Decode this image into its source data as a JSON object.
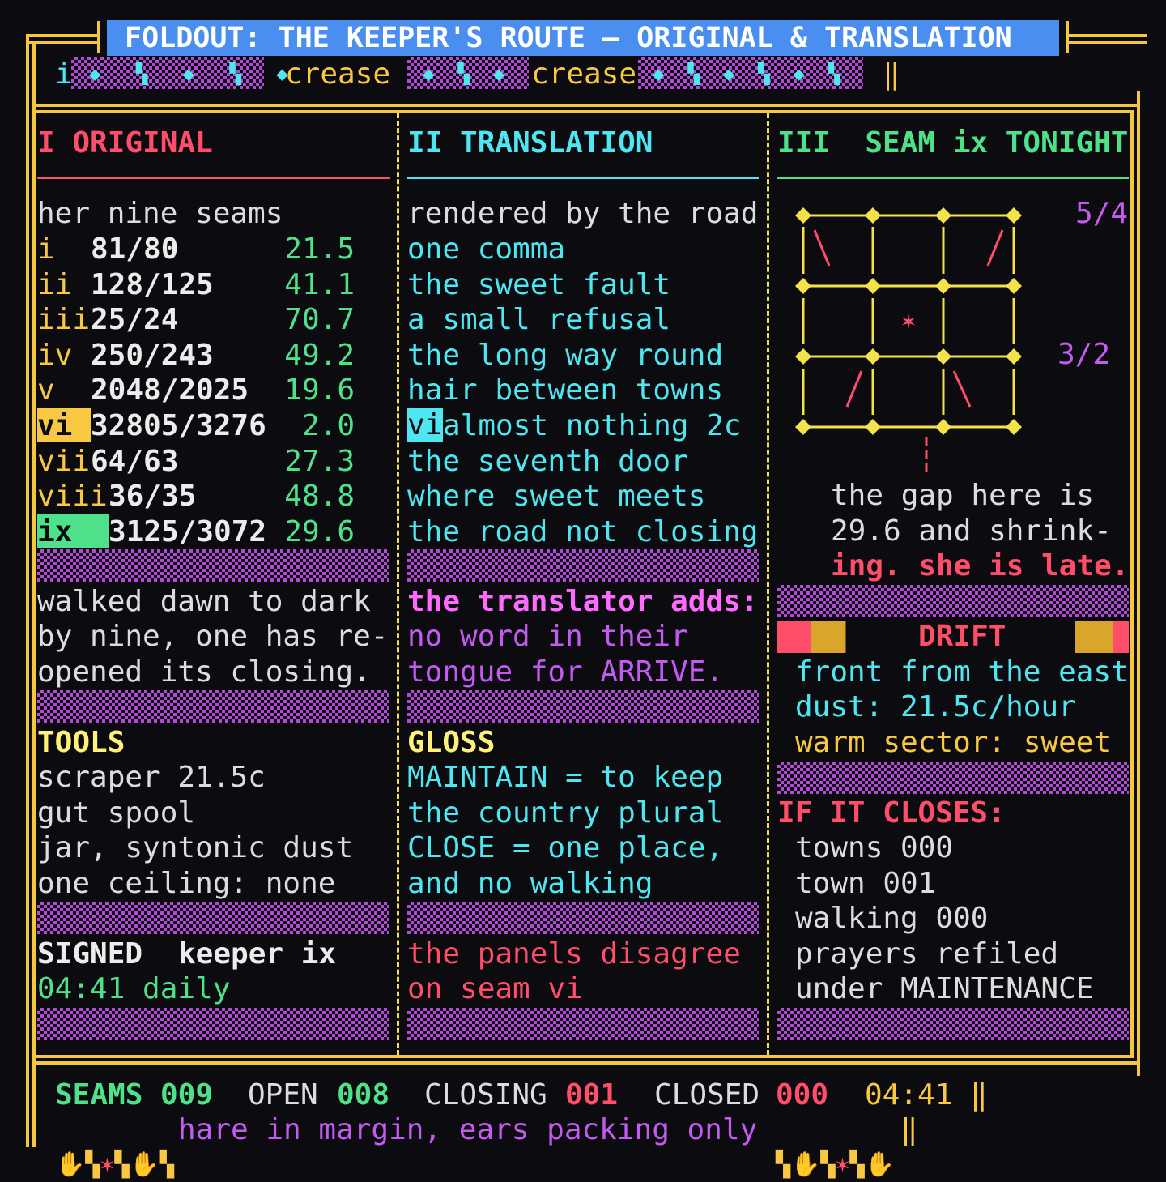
{
  "header": {
    "title": "FOLDOUT: THE KEEPER'S ROUTE — ORIGINAL & TRANSLATION",
    "ruler_left": "i",
    "crease_1": "crease",
    "crease_2": "crease"
  },
  "col1": {
    "heading": "I ORIGINAL",
    "intro": "her nine seams",
    "seams": [
      {
        "id": "i",
        "ratio": "81/80",
        "cents": "21.5"
      },
      {
        "id": "ii",
        "ratio": "128/125",
        "cents": "41.1"
      },
      {
        "id": "iii",
        "ratio": "25/24",
        "cents": "70.7"
      },
      {
        "id": "iv",
        "ratio": "250/243",
        "cents": "49.2"
      },
      {
        "id": "v",
        "ratio": "2048/2025",
        "cents": "19.6"
      },
      {
        "id": "vi",
        "ratio": "32805/3276",
        "cents": "2.0"
      },
      {
        "id": "vii",
        "ratio": "64/63",
        "cents": "27.3"
      },
      {
        "id": "viii",
        "ratio": "36/35",
        "cents": "48.8"
      },
      {
        "id": "ix",
        "ratio": "3125/3072",
        "cents": "29.6"
      }
    ],
    "para": [
      "walked dawn to dark",
      "by nine, one has re-",
      "opened its closing."
    ],
    "tools_heading": "TOOLS",
    "tools": [
      "scraper 21.5c",
      "gut spool",
      "jar, syntonic dust",
      "one ceiling: none"
    ],
    "signed_label": "SIGNED",
    "signed_name": "keeper ix",
    "signed_time": "04:41 daily"
  },
  "col2": {
    "heading": "II TRANSLATION",
    "intro": "rendered by the road",
    "lines": [
      "one comma",
      "the sweet fault",
      "a small refusal",
      "the long way round",
      "hair between towns",
      "almost nothing 2c",
      "the seventh door",
      "where sweet meets",
      "the road not closing"
    ],
    "vi_mark": "vi",
    "adds_heading": "the translator adds:",
    "adds": [
      "no word in their",
      "tongue for ARRIVE."
    ],
    "gloss_heading": "GLOSS",
    "gloss": [
      "MAINTAIN = to keep",
      "the country plural",
      "CLOSE = one place,",
      "and no walking"
    ],
    "note": [
      "the panels disagree",
      "on seam vi"
    ]
  },
  "col3": {
    "heading": "III  SEAM ix TONIGHT",
    "ratio_a": "5/4",
    "ratio_b": "3/2",
    "star": "✶",
    "gap": [
      "the gap here is",
      "29.6 and shrink-"
    ],
    "gap_alert": "ing. she is late.",
    "drift_heading": "DRIFT",
    "drift": [
      "front from the east",
      "dust: 21.5c/hour"
    ],
    "drift_warm": "warm sector: sweet",
    "closes_heading": "IF IT CLOSES:",
    "closes": [
      "towns 000",
      "town 001",
      "walking 000",
      "prayers refiled",
      "under MAINTENANCE"
    ]
  },
  "footer": {
    "seams_label": "SEAMS",
    "seams_val": "009",
    "open_label": "OPEN",
    "open_val": "008",
    "closing_label": "CLOSING",
    "closing_val": "001",
    "closed_label": "CLOSED",
    "closed_val": "000",
    "time": "04:41",
    "note": "hare in margin, ears packing only"
  },
  "colors": {
    "accent_blue": "#4a8ff0",
    "frame": "#f3c740",
    "pink": "#ff4d6a",
    "cyan": "#4ee6f0",
    "green": "#4fe08a",
    "violet": "#c45bf0"
  }
}
